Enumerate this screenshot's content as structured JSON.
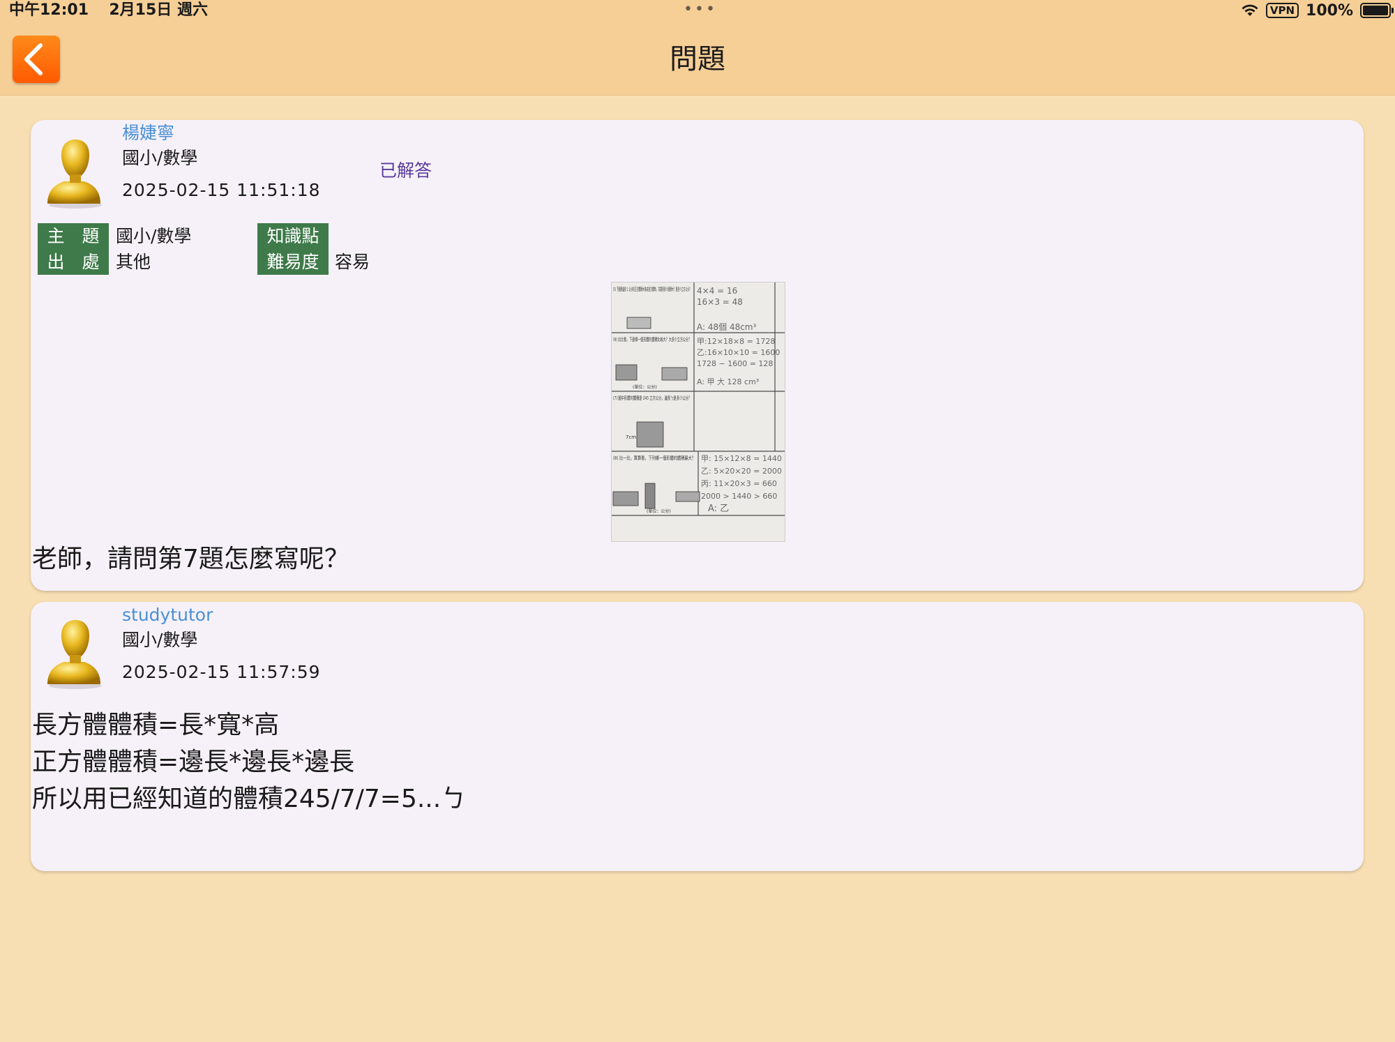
{
  "status_bar": {
    "time": "中午12:01",
    "date": "2月15日 週六",
    "dots": "•••",
    "vpn": "VPN",
    "battery": "100%",
    "battery_level": 1.0
  },
  "nav": {
    "title": "問題",
    "back_icon": "chevron-left-icon"
  },
  "question_post": {
    "username": "楊婕寧",
    "subject": "國小/數學",
    "datetime": "2025-02-15 11:51:18",
    "status": "已解答",
    "tags": [
      {
        "label": "主　題",
        "value": "國小/數學"
      },
      {
        "label": "出　處",
        "value": "其他"
      },
      {
        "label": "知識點",
        "value": ""
      },
      {
        "label": "難易度",
        "value": "容易"
      }
    ],
    "worksheet": {
      "q5": "(5) 下圖用邊長 1 公分的正方體積木排成長方體時，共要用多少個積木？是多少立方公分？",
      "a5": [
        "4×4 = 16",
        "16×3 = 48",
        "A: 48個  48cm³"
      ],
      "q6": "(6) 比比看，下面哪一個形體的體積比較大？大多少立方公分？",
      "a6": [
        "甲:12×18×8 = 1728",
        "乙:16×10×10 = 1600",
        "1728 − 1600 = 128",
        "A: 甲  大 128 cm³"
      ],
      "q7": "(7) 圖中形體的體積是 245 立方公分，邊長ㄅ是多少公分？",
      "q8": "(8) 比一比，算算看，下列哪一個形體的體積最大？",
      "a8": [
        "甲: 15×12×8 = 1440",
        "乙: 5×20×20 = 2000",
        "丙: 11×20×3 = 660",
        "2000 > 1440 > 660",
        "A: 乙"
      ],
      "unit_note": "(單位：公分)",
      "label_7cm": "7cm"
    },
    "question_text": "老師，請問第7題怎麼寫呢？"
  },
  "answer_post": {
    "username": "studytutor",
    "subject": "國小/數學",
    "datetime": "2025-02-15 11:57:59",
    "answer_lines": [
      "長方體體積=長*寬*高",
      "正方體體積=邊長*邊長*邊長",
      "所以用已經知道的體積245/7/7=5...ㄅ"
    ]
  },
  "colors": {
    "background": "#f8dfb3",
    "navbar": "#f6cf97",
    "card": "#f6f1f9",
    "username": "#4a8fd4",
    "status": "#5a3b9a",
    "tag": "#3f7a4a",
    "back_button": "#ff6a00"
  }
}
